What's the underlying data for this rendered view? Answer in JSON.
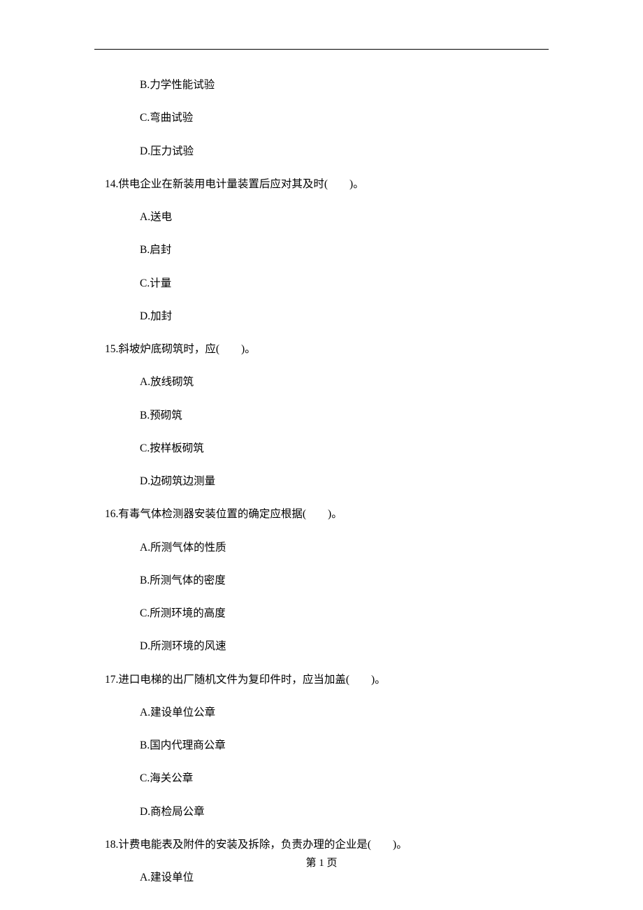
{
  "options_pre": [
    "B.力学性能试验",
    "C.弯曲试验",
    "D.压力试验"
  ],
  "questions": [
    {
      "stem": "14.供电企业在新装用电计量装置后应对其及时(　　)。",
      "options": [
        "A.送电",
        "B.启封",
        "C.计量",
        "D.加封"
      ]
    },
    {
      "stem": "15.斜坡炉底砌筑时，应(　　)。",
      "options": [
        "A.放线砌筑",
        "B.预砌筑",
        "C.按样板砌筑",
        "D.边砌筑边测量"
      ]
    },
    {
      "stem": "16.有毒气体检测器安装位置的确定应根据(　　)。",
      "options": [
        "A.所测气体的性质",
        "B.所测气体的密度",
        "C.所测环境的高度",
        "D.所测环境的风速"
      ]
    },
    {
      "stem": "17.进口电梯的出厂随机文件为复印件时，应当加盖(　　)。",
      "options": [
        "A.建设单位公章",
        "B.国内代理商公章",
        "C.海关公章",
        "D.商检局公章"
      ]
    },
    {
      "stem": "18.计费电能表及附件的安装及拆除，负责办理的企业是(　　)。",
      "options": [
        "A.建设单位"
      ]
    }
  ],
  "footer": "第 1 页"
}
